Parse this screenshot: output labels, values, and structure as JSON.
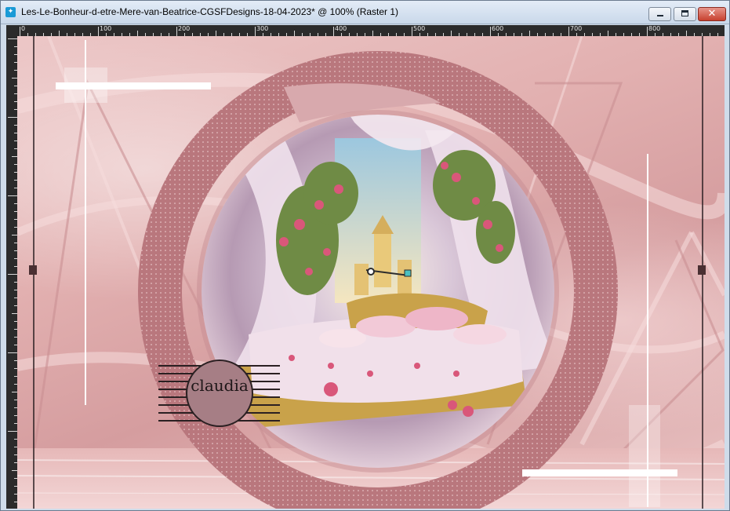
{
  "window": {
    "title": "Les-Le-Bonheur-d-etre-Mere-van-Beatrice-CGSFDesigns-18-04-2023* @ 100% (Raster 1)",
    "app_icon_glyph": "✦",
    "close_glyph": "✕"
  },
  "ruler": {
    "labels": [
      "0",
      "100",
      "200",
      "300",
      "400",
      "500",
      "600",
      "700",
      "800"
    ]
  },
  "canvas": {
    "watermark_text": "claudia",
    "colors": {
      "frame_ring": "#b9777d",
      "background": "#e2b0b0",
      "accent_gold": "#c9a24a",
      "rose": "#d9577a"
    }
  }
}
